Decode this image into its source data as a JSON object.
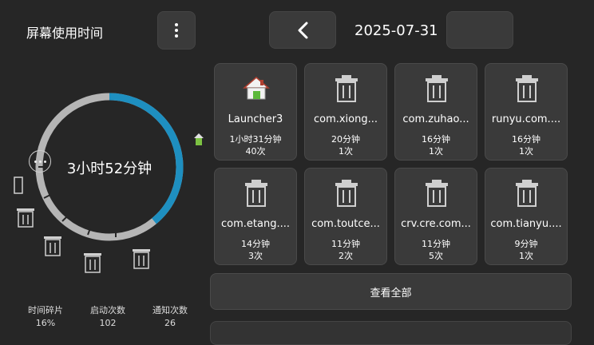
{
  "header": {
    "title": "屏幕使用时间",
    "date": "2025-07-31"
  },
  "summary": {
    "total": "3小时52分钟",
    "ring_fraction_highlight": 0.39,
    "accent": "#1e8fc0",
    "ring_base": "#b5b5b5"
  },
  "stats": [
    {
      "label": "时间碎片",
      "value": "16%"
    },
    {
      "label": "启动次数",
      "value": "102"
    },
    {
      "label": "通知次数",
      "value": "26"
    }
  ],
  "apps": [
    {
      "name": "Launcher3",
      "duration": "1小时31分钟",
      "count": "40次",
      "icon": "home-icon"
    },
    {
      "name": "com.xiong...",
      "duration": "20分钟",
      "count": "1次",
      "icon": "trash-icon"
    },
    {
      "name": "com.zuhao...",
      "duration": "16分钟",
      "count": "1次",
      "icon": "trash-icon"
    },
    {
      "name": "runyu.com....",
      "duration": "16分钟",
      "count": "1次",
      "icon": "trash-icon"
    },
    {
      "name": "com.etang....",
      "duration": "14分钟",
      "count": "3次",
      "icon": "trash-icon"
    },
    {
      "name": "com.toutce...",
      "duration": "11分钟",
      "count": "2次",
      "icon": "trash-icon"
    },
    {
      "name": "crv.cre.com...",
      "duration": "11分钟",
      "count": "5次",
      "icon": "trash-icon"
    },
    {
      "name": "com.tianyu....",
      "duration": "9分钟",
      "count": "1次",
      "icon": "trash-icon"
    }
  ],
  "view_all_label": "查看全部"
}
